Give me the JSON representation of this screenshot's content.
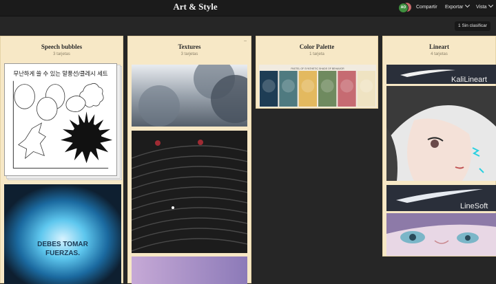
{
  "header": {
    "title": "Art & Style",
    "avatars": [
      "AO",
      "C"
    ],
    "share_label": "Compartir",
    "export_label": "Exportar",
    "view_label": "Vista"
  },
  "filter": {
    "count": "1",
    "label": "Sin clasificar"
  },
  "columns": [
    {
      "title": "Speech bubbles",
      "count": "3 tarjetas",
      "cards": [
        {
          "kind": "speech-bubble-sheet",
          "text": "무난하게 쓸 수 있는 말풍선/클레시 세트"
        },
        {
          "kind": "glow-text-image",
          "text_line1": "DEBES TOMAR",
          "text_line2": "FUERZAS."
        }
      ]
    },
    {
      "title": "Textures",
      "count": "3 tarjetas",
      "cards": [
        {
          "kind": "cloud-texture"
        },
        {
          "kind": "dark-wave-texture"
        },
        {
          "kind": "purple-texture"
        }
      ]
    },
    {
      "title": "Color Palette",
      "count": "1 tarjeta",
      "cards": [
        {
          "kind": "palette",
          "header": "PASTEL OF SYNTHETIC SHADE OF BEHAVIOR",
          "swatches": [
            "#1e3d55",
            "#4f7a80",
            "#e3b95f",
            "#6f8a5f",
            "#c66b72",
            "#efe3c2"
          ]
        }
      ]
    },
    {
      "title": "Lineart",
      "count": "4 tarjetas",
      "cards": [
        {
          "kind": "brush-stroke",
          "label": "KaliLineart"
        },
        {
          "kind": "anime-portrait"
        },
        {
          "kind": "brush-stroke",
          "label": "LineSoft"
        },
        {
          "kind": "anime-eyes"
        }
      ]
    }
  ]
}
